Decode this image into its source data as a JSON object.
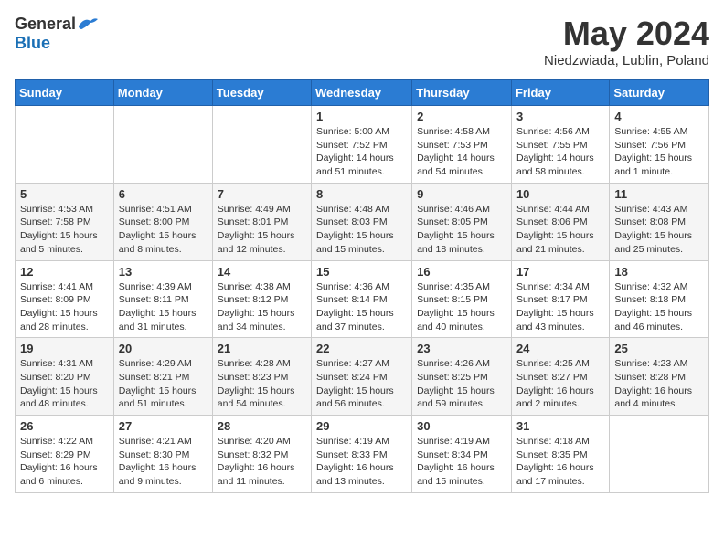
{
  "logo": {
    "general": "General",
    "blue": "Blue"
  },
  "title": "May 2024",
  "location": "Niedzwiada, Lublin, Poland",
  "days_of_week": [
    "Sunday",
    "Monday",
    "Tuesday",
    "Wednesday",
    "Thursday",
    "Friday",
    "Saturday"
  ],
  "weeks": [
    [
      {
        "day": "",
        "info": ""
      },
      {
        "day": "",
        "info": ""
      },
      {
        "day": "",
        "info": ""
      },
      {
        "day": "1",
        "info": "Sunrise: 5:00 AM\nSunset: 7:52 PM\nDaylight: 14 hours\nand 51 minutes."
      },
      {
        "day": "2",
        "info": "Sunrise: 4:58 AM\nSunset: 7:53 PM\nDaylight: 14 hours\nand 54 minutes."
      },
      {
        "day": "3",
        "info": "Sunrise: 4:56 AM\nSunset: 7:55 PM\nDaylight: 14 hours\nand 58 minutes."
      },
      {
        "day": "4",
        "info": "Sunrise: 4:55 AM\nSunset: 7:56 PM\nDaylight: 15 hours\nand 1 minute."
      }
    ],
    [
      {
        "day": "5",
        "info": "Sunrise: 4:53 AM\nSunset: 7:58 PM\nDaylight: 15 hours\nand 5 minutes."
      },
      {
        "day": "6",
        "info": "Sunrise: 4:51 AM\nSunset: 8:00 PM\nDaylight: 15 hours\nand 8 minutes."
      },
      {
        "day": "7",
        "info": "Sunrise: 4:49 AM\nSunset: 8:01 PM\nDaylight: 15 hours\nand 12 minutes."
      },
      {
        "day": "8",
        "info": "Sunrise: 4:48 AM\nSunset: 8:03 PM\nDaylight: 15 hours\nand 15 minutes."
      },
      {
        "day": "9",
        "info": "Sunrise: 4:46 AM\nSunset: 8:05 PM\nDaylight: 15 hours\nand 18 minutes."
      },
      {
        "day": "10",
        "info": "Sunrise: 4:44 AM\nSunset: 8:06 PM\nDaylight: 15 hours\nand 21 minutes."
      },
      {
        "day": "11",
        "info": "Sunrise: 4:43 AM\nSunset: 8:08 PM\nDaylight: 15 hours\nand 25 minutes."
      }
    ],
    [
      {
        "day": "12",
        "info": "Sunrise: 4:41 AM\nSunset: 8:09 PM\nDaylight: 15 hours\nand 28 minutes."
      },
      {
        "day": "13",
        "info": "Sunrise: 4:39 AM\nSunset: 8:11 PM\nDaylight: 15 hours\nand 31 minutes."
      },
      {
        "day": "14",
        "info": "Sunrise: 4:38 AM\nSunset: 8:12 PM\nDaylight: 15 hours\nand 34 minutes."
      },
      {
        "day": "15",
        "info": "Sunrise: 4:36 AM\nSunset: 8:14 PM\nDaylight: 15 hours\nand 37 minutes."
      },
      {
        "day": "16",
        "info": "Sunrise: 4:35 AM\nSunset: 8:15 PM\nDaylight: 15 hours\nand 40 minutes."
      },
      {
        "day": "17",
        "info": "Sunrise: 4:34 AM\nSunset: 8:17 PM\nDaylight: 15 hours\nand 43 minutes."
      },
      {
        "day": "18",
        "info": "Sunrise: 4:32 AM\nSunset: 8:18 PM\nDaylight: 15 hours\nand 46 minutes."
      }
    ],
    [
      {
        "day": "19",
        "info": "Sunrise: 4:31 AM\nSunset: 8:20 PM\nDaylight: 15 hours\nand 48 minutes."
      },
      {
        "day": "20",
        "info": "Sunrise: 4:29 AM\nSunset: 8:21 PM\nDaylight: 15 hours\nand 51 minutes."
      },
      {
        "day": "21",
        "info": "Sunrise: 4:28 AM\nSunset: 8:23 PM\nDaylight: 15 hours\nand 54 minutes."
      },
      {
        "day": "22",
        "info": "Sunrise: 4:27 AM\nSunset: 8:24 PM\nDaylight: 15 hours\nand 56 minutes."
      },
      {
        "day": "23",
        "info": "Sunrise: 4:26 AM\nSunset: 8:25 PM\nDaylight: 15 hours\nand 59 minutes."
      },
      {
        "day": "24",
        "info": "Sunrise: 4:25 AM\nSunset: 8:27 PM\nDaylight: 16 hours\nand 2 minutes."
      },
      {
        "day": "25",
        "info": "Sunrise: 4:23 AM\nSunset: 8:28 PM\nDaylight: 16 hours\nand 4 minutes."
      }
    ],
    [
      {
        "day": "26",
        "info": "Sunrise: 4:22 AM\nSunset: 8:29 PM\nDaylight: 16 hours\nand 6 minutes."
      },
      {
        "day": "27",
        "info": "Sunrise: 4:21 AM\nSunset: 8:30 PM\nDaylight: 16 hours\nand 9 minutes."
      },
      {
        "day": "28",
        "info": "Sunrise: 4:20 AM\nSunset: 8:32 PM\nDaylight: 16 hours\nand 11 minutes."
      },
      {
        "day": "29",
        "info": "Sunrise: 4:19 AM\nSunset: 8:33 PM\nDaylight: 16 hours\nand 13 minutes."
      },
      {
        "day": "30",
        "info": "Sunrise: 4:19 AM\nSunset: 8:34 PM\nDaylight: 16 hours\nand 15 minutes."
      },
      {
        "day": "31",
        "info": "Sunrise: 4:18 AM\nSunset: 8:35 PM\nDaylight: 16 hours\nand 17 minutes."
      },
      {
        "day": "",
        "info": ""
      }
    ]
  ]
}
